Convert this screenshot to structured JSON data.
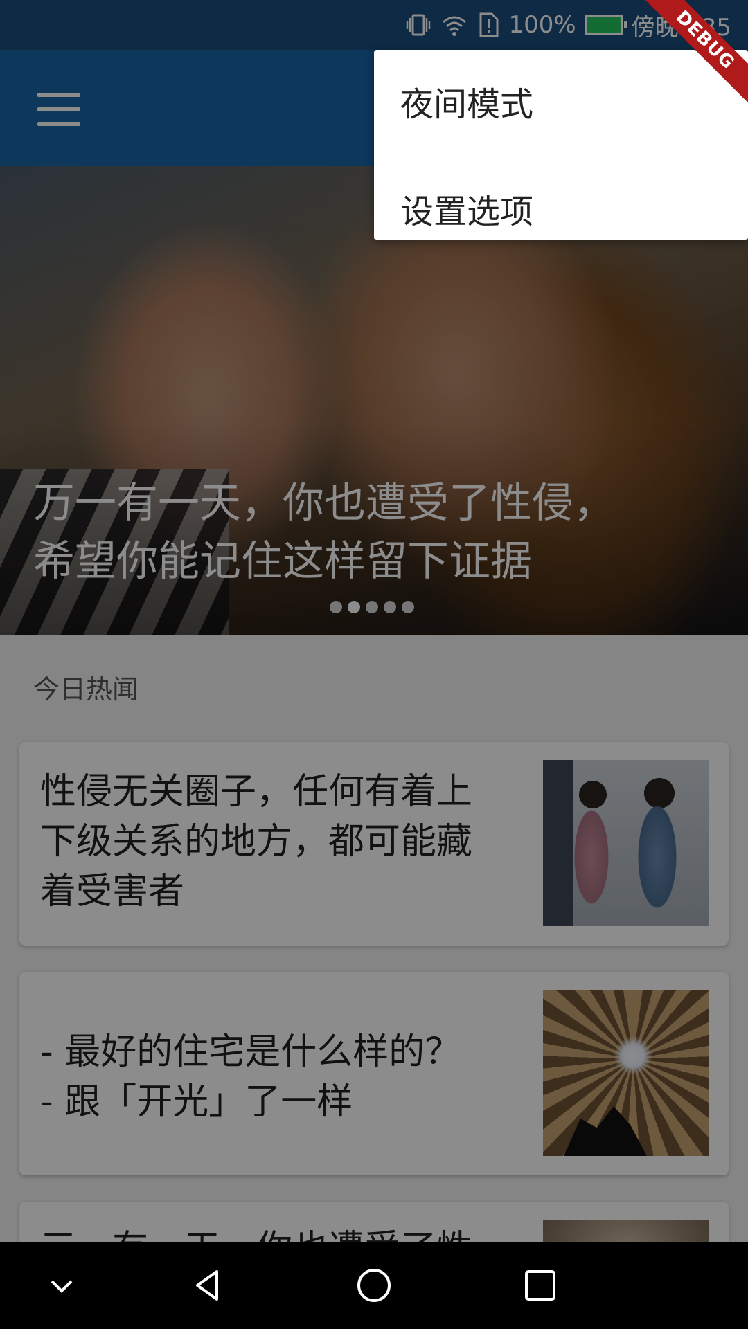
{
  "status_bar": {
    "battery_percent": "100%",
    "time": "傍晚6:35",
    "icons": [
      "vibrate-icon",
      "wifi-icon",
      "sim-alert-icon",
      "battery-charging-icon"
    ],
    "background": "#1a4d7c"
  },
  "app_bar": {
    "color": "#1b64a8",
    "menu_icon": "hamburger-menu-icon"
  },
  "hero": {
    "title": "万一有一天，你也遭受了性侵，\n希望你能记住这样留下证据",
    "dots_total": 5,
    "dots_active_index": 1
  },
  "section": {
    "title": "今日热闻"
  },
  "stories": [
    {
      "title": "性侵无关圈子，任何有着上\n下级关系的地方，都可能藏\n着受害者"
    },
    {
      "title": "- 最好的住宅是什么样的？\n- 跟「开光」了一样"
    },
    {
      "title": "三一有一天，你也遭受了性"
    }
  ],
  "popup_menu": {
    "items": [
      {
        "label": "夜间模式"
      },
      {
        "label": "设置选项"
      }
    ]
  },
  "debug_banner": "DEBUG",
  "nav_bar": {
    "icons": [
      "collapse-icon",
      "back-icon",
      "home-icon",
      "recents-icon"
    ]
  }
}
